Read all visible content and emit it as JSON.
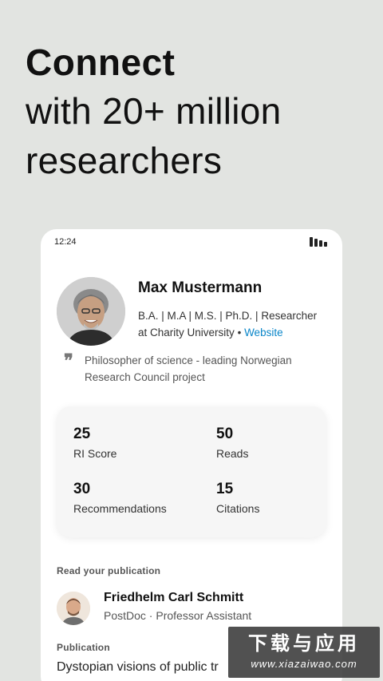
{
  "headline": {
    "line1": "Connect",
    "line2": "with 20+ million",
    "line3": "researchers"
  },
  "status_bar": {
    "time": "12:24"
  },
  "profile": {
    "name": "Max Mustermann",
    "degrees": "B.A. | M.A | M.S. | Ph.D. | Researcher",
    "affiliation": "at Charity University",
    "separator": "•",
    "website_label": "Website",
    "quote_line1": "Philosopher of science - leading Norwegian",
    "quote_line2": "Research Council project"
  },
  "stats": [
    {
      "value": "25",
      "label": "RI Score"
    },
    {
      "value": "50",
      "label": "Reads"
    },
    {
      "value": "30",
      "label": "Recommendations"
    },
    {
      "value": "15",
      "label": "Citations"
    }
  ],
  "read_section": {
    "title": "Read your publication",
    "author_name": "Friedhelm Carl Schmitt",
    "author_role": "PostDoc · Professor Assistant"
  },
  "publication": {
    "section_title": "Publication",
    "title": "Dystopian visions of public tr"
  },
  "watermark": {
    "line1": "下载与应用",
    "line2": "www.xiazaiwao.com"
  },
  "colors": {
    "background": "#e2e4e1",
    "card": "#ffffff",
    "link": "#0a86c9",
    "stats_panel": "#f6f6f6"
  },
  "icons": [
    "signal-icon",
    "quote-icon"
  ]
}
